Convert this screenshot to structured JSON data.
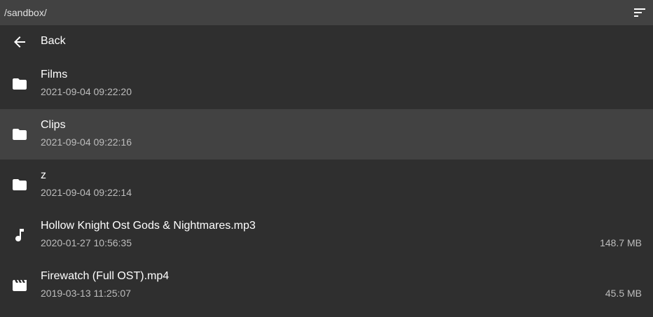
{
  "header": {
    "path": "/sandbox/",
    "sort_icon": "sort-icon"
  },
  "back": {
    "label": "Back",
    "icon": "arrow-left-icon"
  },
  "items": [
    {
      "name": "Films",
      "date": "2021-09-04 09:22:20",
      "size": "",
      "icon": "folder-icon"
    },
    {
      "name": "Clips",
      "date": "2021-09-04 09:22:16",
      "size": "",
      "icon": "folder-icon"
    },
    {
      "name": "z",
      "date": "2021-09-04 09:22:14",
      "size": "",
      "icon": "folder-icon"
    },
    {
      "name": "Hollow Knight Ost Gods & Nightmares.mp3",
      "date": "2020-01-27 10:56:35",
      "size": "148.7 MB",
      "icon": "music-note-icon"
    },
    {
      "name": "Firewatch (Full OST).mp4",
      "date": "2019-03-13 11:25:07",
      "size": "45.5 MB",
      "icon": "movie-icon"
    }
  ],
  "colors": {
    "background": "#2f2f2f",
    "header": "#424242",
    "selected_row": "#424242",
    "secondary_text": "#bdbdbd"
  }
}
